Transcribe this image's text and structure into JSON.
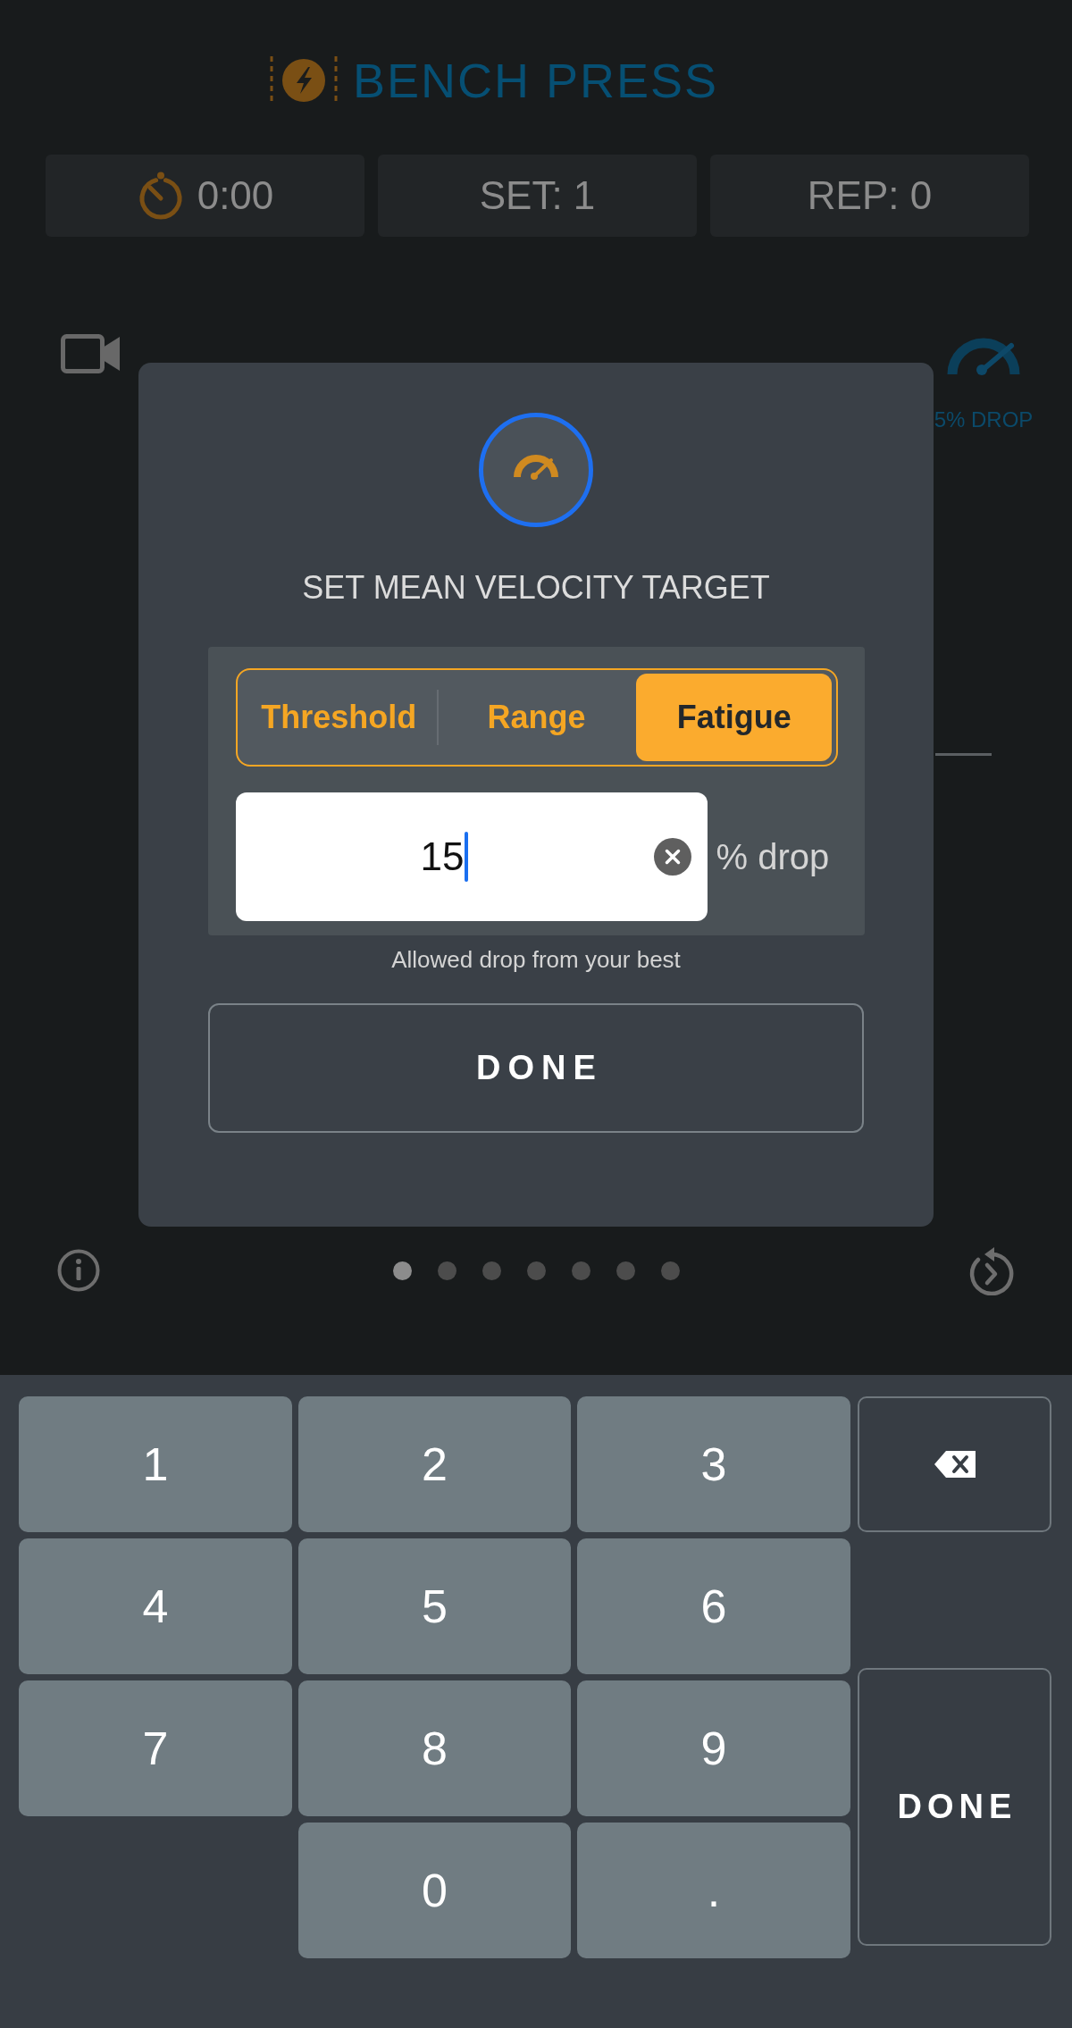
{
  "header": {
    "title": "BENCH PRESS"
  },
  "stats": [
    {
      "kind": "timer",
      "value": "0:00"
    },
    {
      "kind": "count",
      "value": "SET: 1"
    },
    {
      "kind": "count",
      "value": "REP: 0"
    }
  ],
  "velocity_target": {
    "label": "5% DROP"
  },
  "dialog": {
    "title": "SET MEAN VELOCITY TARGET",
    "modes": [
      {
        "label": "Threshold",
        "selected": false
      },
      {
        "label": "Range",
        "selected": false
      },
      {
        "label": "Fatigue",
        "selected": true
      }
    ],
    "input": {
      "value": "15"
    },
    "unit": "% drop",
    "hint": "Allowed drop from your best",
    "done_button": "DONE"
  },
  "pager": {
    "dots": [
      {
        "selected": true
      },
      {
        "selected": false
      },
      {
        "selected": false
      },
      {
        "selected": false
      },
      {
        "selected": false
      },
      {
        "selected": false
      },
      {
        "selected": false
      }
    ]
  },
  "keypad": {
    "keys": [
      {
        "kind": "digit",
        "label": "1"
      },
      {
        "kind": "digit",
        "label": "2"
      },
      {
        "kind": "digit",
        "label": "3"
      },
      {
        "kind": "backspace"
      },
      {
        "kind": "digit",
        "label": "4"
      },
      {
        "kind": "digit",
        "label": "5"
      },
      {
        "kind": "digit",
        "label": "6"
      },
      {
        "kind": "digit",
        "label": "7"
      },
      {
        "kind": "digit",
        "label": "8"
      },
      {
        "kind": "digit",
        "label": "9"
      },
      {
        "kind": "done",
        "label": "DONE"
      },
      {
        "kind": "digit",
        "label": "0"
      },
      {
        "kind": "decimal",
        "label": "."
      }
    ]
  }
}
